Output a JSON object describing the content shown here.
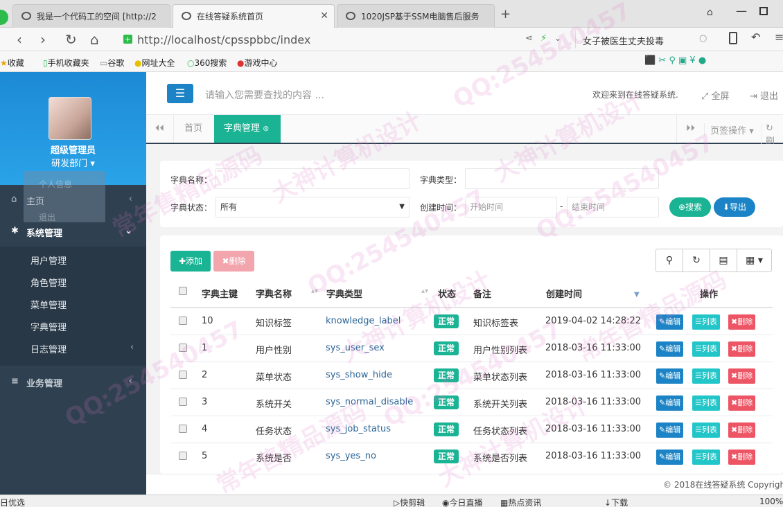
{
  "browser": {
    "tabs": [
      {
        "title": "我是一个代码工的空间 [http://2"
      },
      {
        "title": "在线答疑系统首页",
        "active": true
      },
      {
        "title": "1020JSP基于SSM电脑售后服务"
      }
    ],
    "new_tab": "+",
    "url": "http://localhost/cpsspbbc/index",
    "search_text": "女子被医生丈夫投毒",
    "bookmarks": [
      "收藏",
      "手机收藏夹",
      "谷歌",
      "网址大全",
      "360搜索",
      "游戏中心"
    ]
  },
  "sidebar": {
    "user_name": "超级管理员",
    "user_dept": "研发部门",
    "dropdown_items": [
      "个人信息",
      "退出"
    ],
    "menu": [
      {
        "label": "主页"
      },
      {
        "label": "系统管理"
      },
      {
        "label": "业务管理"
      }
    ],
    "submenu": [
      "用户管理",
      "角色管理",
      "菜单管理",
      "字典管理",
      "日志管理"
    ]
  },
  "header": {
    "search_placeholder": "请输入您需要查找的内容 ...",
    "welcome": "欢迎来到在线答疑系统.",
    "fullscreen": "全屏",
    "logout": "退出"
  },
  "page_tabs": {
    "home": "首页",
    "current": "字典管理",
    "page_ops": "页签操作",
    "refresh": "刷"
  },
  "filter": {
    "name_label": "字典名称：",
    "type_label": "字典类型：",
    "status_label": "字典状态：",
    "status_value": "所有",
    "time_label": "创建时间：",
    "start_placeholder": "开始时间",
    "dash": "-",
    "end_placeholder": "结束时间",
    "search_btn": "搜索",
    "export_btn": "导出"
  },
  "toolbar": {
    "add": "添加",
    "delete": "删除"
  },
  "table": {
    "headers": [
      "字典主键",
      "字典名称",
      "字典类型",
      "状态",
      "备注",
      "创建时间",
      "操作"
    ],
    "rows": [
      {
        "id": "10",
        "name": "知识标签",
        "type": "knowledge_label",
        "status": "正常",
        "remark": "知识标签表",
        "time": "2019-04-02 14:28:22"
      },
      {
        "id": "1",
        "name": "用户性别",
        "type": "sys_user_sex",
        "status": "正常",
        "remark": "用户性别列表",
        "time": "2018-03-16 11:33:00"
      },
      {
        "id": "2",
        "name": "菜单状态",
        "type": "sys_show_hide",
        "status": "正常",
        "remark": "菜单状态列表",
        "time": "2018-03-16 11:33:00"
      },
      {
        "id": "3",
        "name": "系统开关",
        "type": "sys_normal_disable",
        "status": "正常",
        "remark": "系统开关列表",
        "time": "2018-03-16 11:33:00"
      },
      {
        "id": "4",
        "name": "任务状态",
        "type": "sys_job_status",
        "status": "正常",
        "remark": "任务状态列表",
        "time": "2018-03-16 11:33:00"
      },
      {
        "id": "5",
        "name": "系统是否",
        "type": "sys_yes_no",
        "status": "正常",
        "remark": "系统是否列表",
        "time": "2018-03-16 11:33:00"
      }
    ],
    "edit_label": "编辑",
    "list_label": "列表",
    "delete_label": "删除"
  },
  "footer": "© 2018在线答疑系统 Copyright",
  "statusbar": {
    "left": "日优选",
    "items": [
      "快剪辑",
      "今日直播",
      "热点资讯",
      "下载"
    ],
    "zoom": "100%"
  },
  "watermarks": [
    "QQ:254540457",
    "常年售精品源码",
    "大神计算机设计"
  ],
  "colors": {
    "sidebar": "#2f4050",
    "primary": "#1c84c6",
    "success": "#1ab394",
    "danger": "#ed5565",
    "info": "#23c6c8"
  }
}
